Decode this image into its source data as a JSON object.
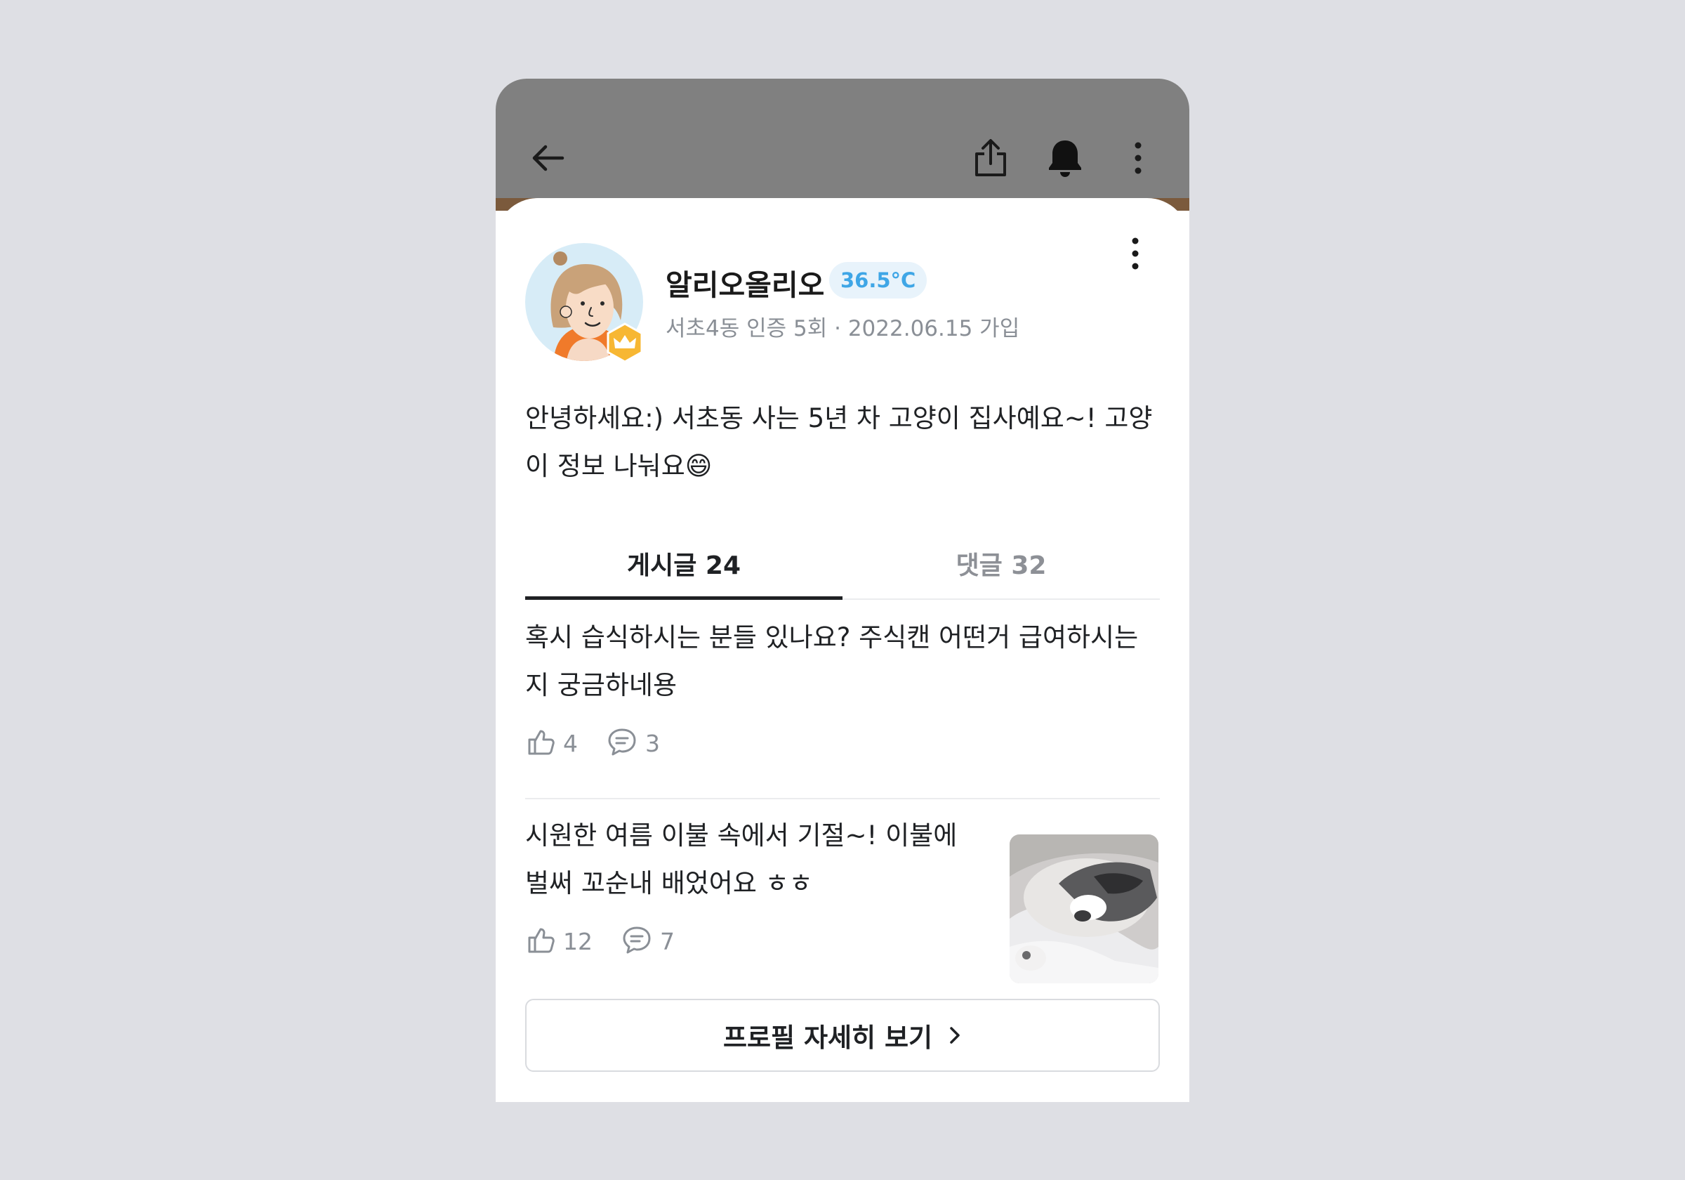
{
  "header": {
    "icons": [
      "back-arrow-icon",
      "share-icon",
      "bell-icon",
      "more-vertical-icon"
    ]
  },
  "profile": {
    "name": "알리오올리오",
    "temperature": "36.5°C",
    "meta": "서초4동 인증 5회 · 2022.06.15 가입",
    "bio": "안녕하세요:) 서초동 사는 5년 차 고양이 집사예요~! 고양이 정보 나눠요😄",
    "badge_icon": "crown-icon",
    "colors": {
      "temperature_bg": "#e8f3fb",
      "temperature_text": "#3fa6e6",
      "badge": "#f7b733"
    }
  },
  "tabs": [
    {
      "label": "게시글 24",
      "active": true
    },
    {
      "label": "댓글 32",
      "active": false
    }
  ],
  "posts": [
    {
      "title": "혹시 습식하시는 분들 있나요? 주식캔 어떤거 급여하시는지 궁금하네용",
      "likes": "4",
      "comments": "3",
      "has_thumbnail": false
    },
    {
      "title": "시원한 여름 이불 속에서 기절~! 이불에 벌써 꼬순내 배었어요 ㅎㅎ",
      "likes": "12",
      "comments": "7",
      "has_thumbnail": true,
      "thumbnail": "sleeping-cat-photo"
    }
  ],
  "footer": {
    "detail_button": "프로필 자세히 보기"
  }
}
